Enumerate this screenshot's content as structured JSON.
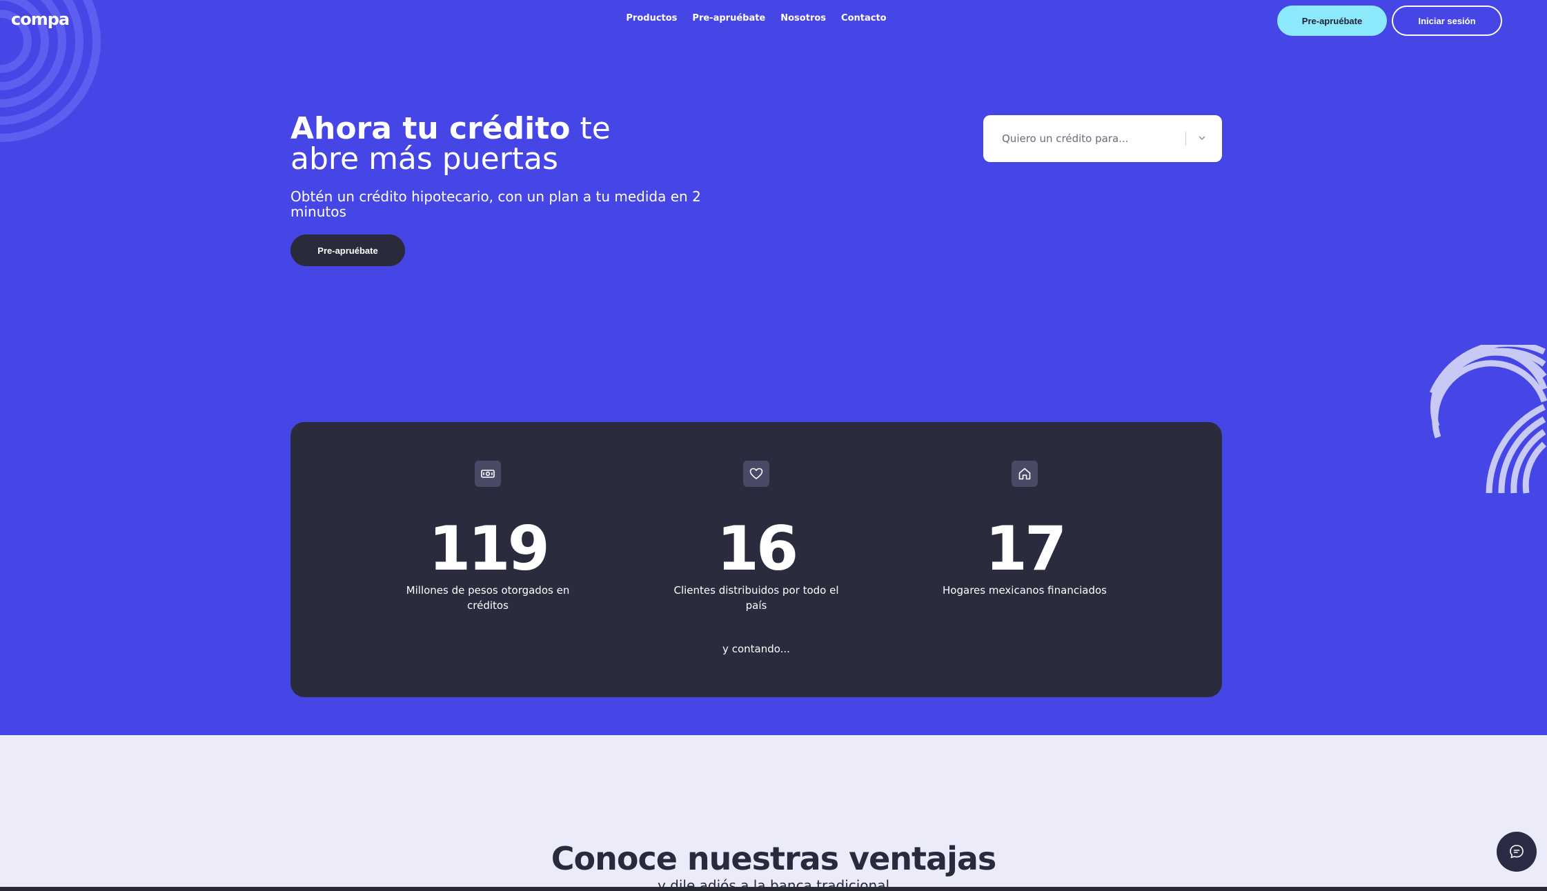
{
  "brand": {
    "logo_text": "compa"
  },
  "nav": {
    "items": [
      {
        "label": "Productos"
      },
      {
        "label": "Pre-apruébate"
      },
      {
        "label": "Nosotros"
      },
      {
        "label": "Contacto"
      }
    ]
  },
  "header": {
    "preapprove_label": "Pre-apruébate",
    "login_label": "Iniciar sesión"
  },
  "hero": {
    "title_bold": "Ahora tu crédito",
    "title_rest_1": " te",
    "title_line_2": "abre más puertas",
    "subtitle": "Obtén un crédito hipotecario, con un plan a tu medida en 2 minutos",
    "cta_label": "Pre-apruébate",
    "select_placeholder": "Quiero un crédito para..."
  },
  "stats": {
    "items": [
      {
        "icon": "money-icon",
        "value": "119",
        "description": "Millones de pesos otorgados en créditos"
      },
      {
        "icon": "heart-icon",
        "value": "16",
        "description": "Clientes distribuidos por todo el país"
      },
      {
        "icon": "home-icon",
        "value": "17",
        "description": "Hogares mexicanos financiados"
      }
    ],
    "footer_text": "y contando..."
  },
  "advantages": {
    "title": "Conoce nuestras ventajas",
    "subtitle": "y dile adiós a la banca tradicional"
  },
  "colors": {
    "primary": "#4646e6",
    "dark": "#2b2b3e",
    "accent_cyan": "#8ce9fb",
    "light_bg": "#ebebfa"
  }
}
